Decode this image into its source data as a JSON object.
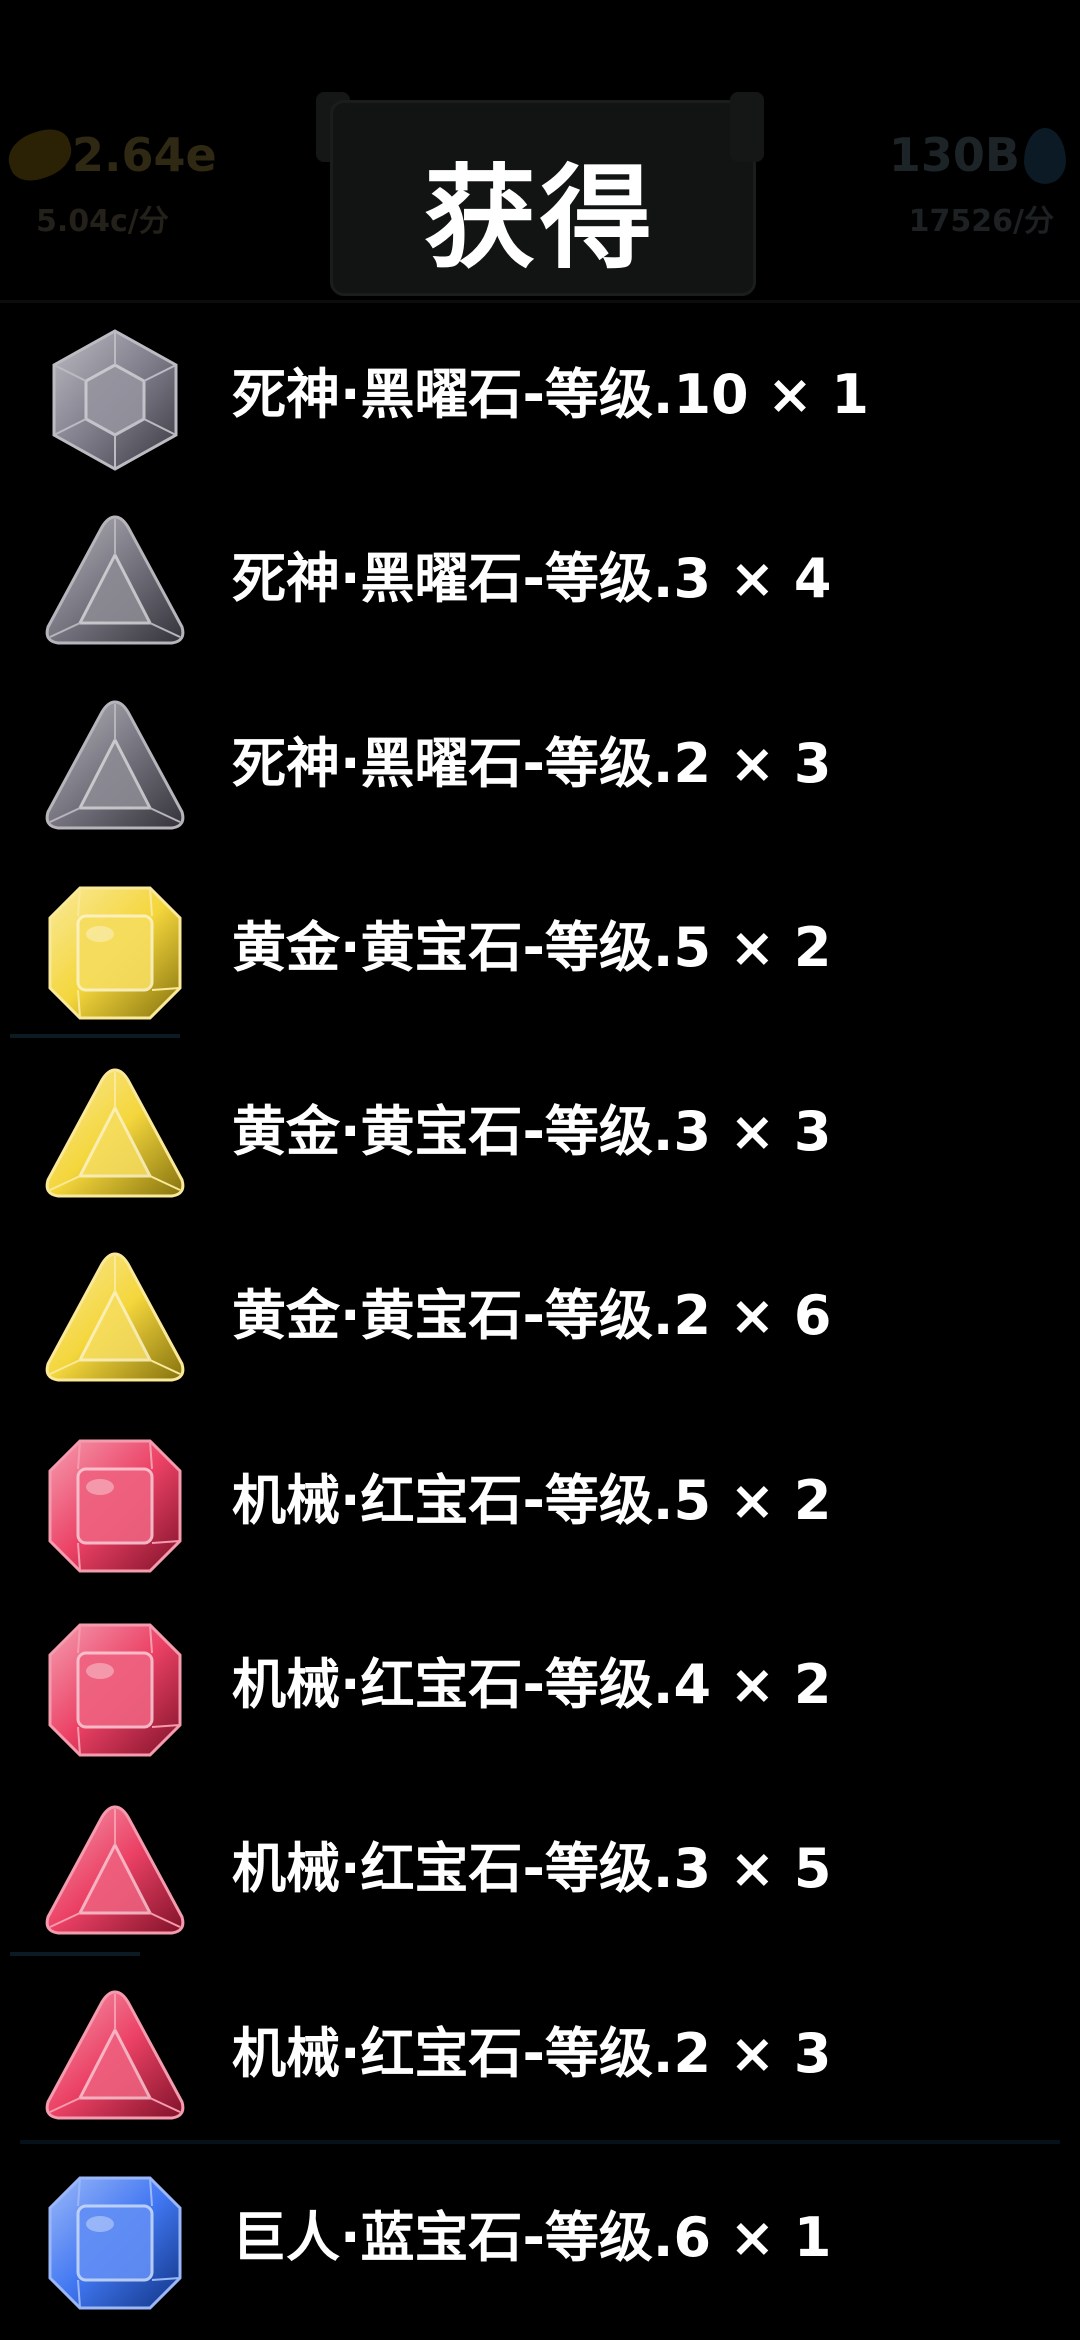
{
  "hud": {
    "gold_value": "2.64e",
    "gold_rate": "5.04c/分",
    "gem_value": "130B",
    "gem_rate": "17526/分"
  },
  "title": "获得",
  "rewards": [
    {
      "label": "死神·黑曜石-等级.10 × 1",
      "gem": "obsidian-hexagon-gem-icon",
      "shape": "hex",
      "color": "#6a6777"
    },
    {
      "label": "死神·黑曜石-等级.3 × 4",
      "gem": "obsidian-triangle-gem-icon",
      "shape": "tri",
      "color": "#5e5b68"
    },
    {
      "label": "死神·黑曜石-等级.2 × 3",
      "gem": "obsidian-triangle-gem-icon",
      "shape": "tri",
      "color": "#5e5b68"
    },
    {
      "label": "黄金·黄宝石-等级.5 × 2",
      "gem": "topaz-square-gem-icon",
      "shape": "sq",
      "color": "#f2cf1a"
    },
    {
      "label": "黄金·黄宝石-等级.3 × 3",
      "gem": "topaz-triangle-gem-icon",
      "shape": "tri",
      "color": "#f2cf1a"
    },
    {
      "label": "黄金·黄宝石-等级.2 × 6",
      "gem": "topaz-triangle-gem-icon",
      "shape": "tri",
      "color": "#f2cf1a"
    },
    {
      "label": "机械·红宝石-等级.5 × 2",
      "gem": "ruby-square-gem-icon",
      "shape": "sq",
      "color": "#e8204a"
    },
    {
      "label": "机械·红宝石-等级.4 × 2",
      "gem": "ruby-square-gem-icon",
      "shape": "sq",
      "color": "#e8204a"
    },
    {
      "label": "机械·红宝石-等级.3 × 5",
      "gem": "ruby-triangle-gem-icon",
      "shape": "tri",
      "color": "#e8204a"
    },
    {
      "label": "机械·红宝石-等级.2 × 3",
      "gem": "ruby-triangle-gem-icon",
      "shape": "tri",
      "color": "#e8204a"
    },
    {
      "label": "巨人·蓝宝石-等级.6 × 1",
      "gem": "sapphire-square-gem-icon",
      "shape": "sq",
      "color": "#1f5ff0"
    }
  ]
}
